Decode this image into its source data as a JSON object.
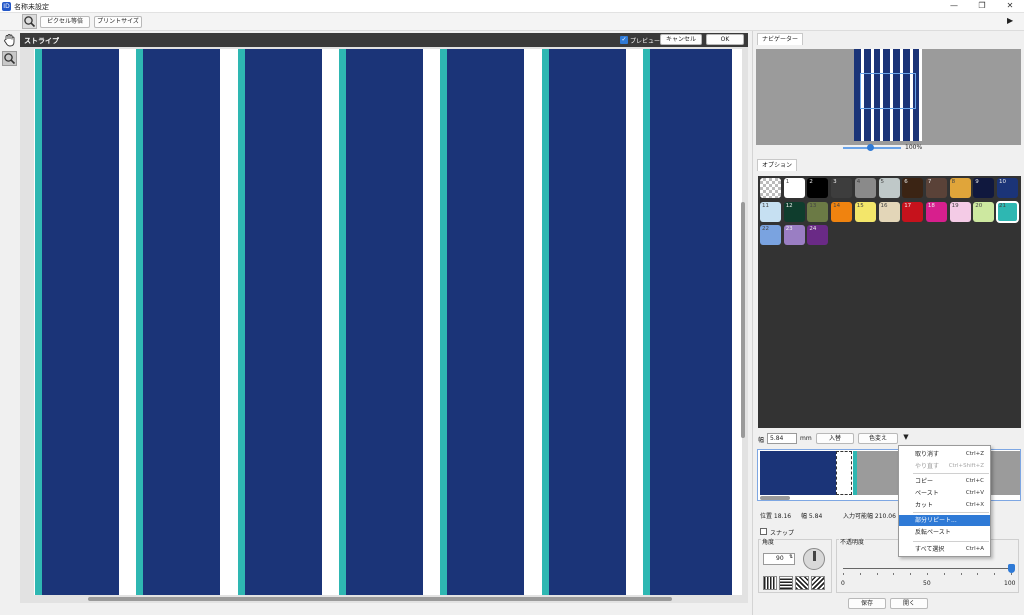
{
  "window": {
    "title": "名称未設定",
    "app_icon": "ID",
    "controls": {
      "minimize": "—",
      "maximize": "❐",
      "close": "✕"
    }
  },
  "toolbar": {
    "zoom_icon": "magnifier-icon",
    "pixel_equal": "ピクセル等倍",
    "print_size": "プリントサイズ",
    "collapse_icon": "▶"
  },
  "tools": {
    "hand": "✋",
    "zoom": "🔍"
  },
  "canvas": {
    "title": "ストライプ",
    "preview_label": "プレビュー",
    "preview_checked": true,
    "cancel_label": "キャンセル",
    "ok_label": "OK",
    "colors": {
      "teal": "#2eb7b2",
      "navy": "#1b3478",
      "white": "#ffffff"
    }
  },
  "navigator": {
    "tab": "ナビゲーター",
    "zoom": "100%"
  },
  "options": {
    "tab": "オプション",
    "swatches": [
      {
        "n": "",
        "color": "checker"
      },
      {
        "n": "1",
        "color": "#ffffff"
      },
      {
        "n": "2",
        "color": "#000000"
      },
      {
        "n": "3",
        "color": "#3d3d3d"
      },
      {
        "n": "4",
        "color": "#8a8a8a"
      },
      {
        "n": "5",
        "color": "#bfc8c8"
      },
      {
        "n": "6",
        "color": "#3b2414"
      },
      {
        "n": "7",
        "color": "#5a4238"
      },
      {
        "n": "8",
        "color": "#e0a53a"
      },
      {
        "n": "9",
        "color": "#10183e"
      },
      {
        "n": "10",
        "color": "#1b3478"
      },
      {
        "n": "11",
        "color": "#c6e0f2"
      },
      {
        "n": "12",
        "color": "#0f3d2d"
      },
      {
        "n": "13",
        "color": "#6b7a45"
      },
      {
        "n": "14",
        "color": "#f0830f"
      },
      {
        "n": "15",
        "color": "#f3e66a"
      },
      {
        "n": "16",
        "color": "#e3d6b8"
      },
      {
        "n": "17",
        "color": "#c6121c"
      },
      {
        "n": "18",
        "color": "#d71f8d"
      },
      {
        "n": "19",
        "color": "#f4cbe6"
      },
      {
        "n": "20",
        "color": "#cde8a0"
      },
      {
        "n": "21",
        "color": "#2eb7b2"
      },
      {
        "n": "22",
        "color": "#7aa3e0"
      },
      {
        "n": "23",
        "color": "#9a7ec3"
      },
      {
        "n": "24",
        "color": "#6a2a86"
      }
    ]
  },
  "stripe_controls": {
    "width_label": "幅",
    "width_value": "5.84",
    "unit": "mm",
    "swap_label": "入替",
    "recolor_label": "色変え",
    "dropdown_icon": "▼",
    "position_label": "位置 18.16",
    "width_info": "幅 5.84",
    "input_width": "入力可能幅 210.06",
    "snap_label": "スナップ",
    "snap_checked": false,
    "angle_label": "角度",
    "angle_value": "90",
    "opacity_label": "不透明度",
    "opacity_ticks": [
      "0",
      "50",
      "100"
    ],
    "opacity_value": 100,
    "save_label": "保存",
    "open_label": "開く"
  },
  "context_menu": {
    "items": [
      {
        "label": "取り消す",
        "shortcut": "Ctrl+Z",
        "state": "normal"
      },
      {
        "label": "やり直す",
        "shortcut": "Ctrl+Shift+Z",
        "state": "disabled"
      },
      {
        "label": "コピー",
        "shortcut": "Ctrl+C",
        "state": "normal"
      },
      {
        "label": "ペースト",
        "shortcut": "Ctrl+V",
        "state": "normal"
      },
      {
        "label": "カット",
        "shortcut": "Ctrl+X",
        "state": "normal"
      },
      {
        "label": "部分リピート...",
        "shortcut": "",
        "state": "highlight"
      },
      {
        "label": "反転ペースト",
        "shortcut": "",
        "state": "normal"
      },
      {
        "label": "すべて選択",
        "shortcut": "Ctrl+A",
        "state": "normal"
      }
    ]
  }
}
